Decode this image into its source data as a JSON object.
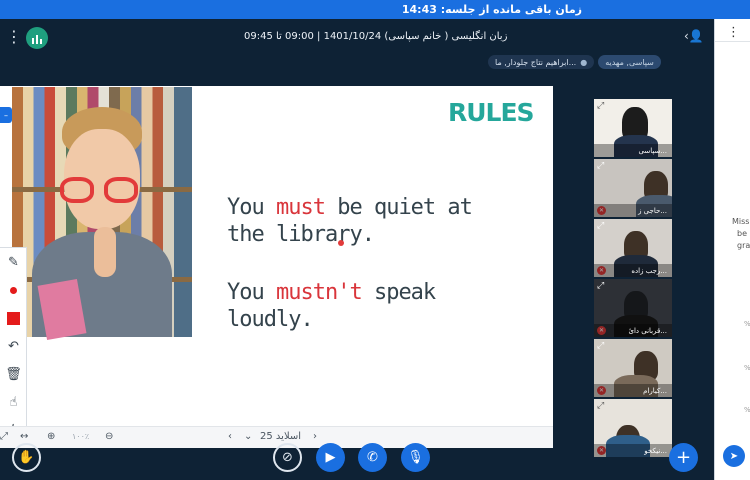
{
  "timer": {
    "text": "زمان باقی مانده از جلسه: 14:43"
  },
  "header": {
    "meeting_title": "زبان انگلیسی ( خانم سپاسی) 1401/10/24 | 09:00 تا 09:45"
  },
  "presenters": {
    "viewer_chip": "سپاسی, مهدیه",
    "presenter_chip": "ابراهیم نتاج جلودار, ما..."
  },
  "slide": {
    "title": "RULES",
    "line1a": "You ",
    "line1b": "must",
    "line1c": " be quiet at",
    "line2": "the library.",
    "line3a": "You ",
    "line3b": "mustn't",
    "line3c": " speak",
    "line4": "loudly."
  },
  "slide_nav": {
    "zoom": "۱۰۰٪",
    "slide_label": "اسلاید 25"
  },
  "participants": [
    {
      "name": "سپاسی..."
    },
    {
      "name": "حاجی ز..."
    },
    {
      "name": "رجب زاده..."
    },
    {
      "name": "قربانی دائ..."
    },
    {
      "name": "کیارام..."
    },
    {
      "name": "نیکخو..."
    }
  ],
  "side_panel": {
    "text1": "Miss",
    "text2": "be",
    "text3": "gra",
    "pct": "%"
  },
  "colors": {
    "accent": "#1a6fe0",
    "highlight": "#d9353b",
    "rules": "#25a79b"
  }
}
